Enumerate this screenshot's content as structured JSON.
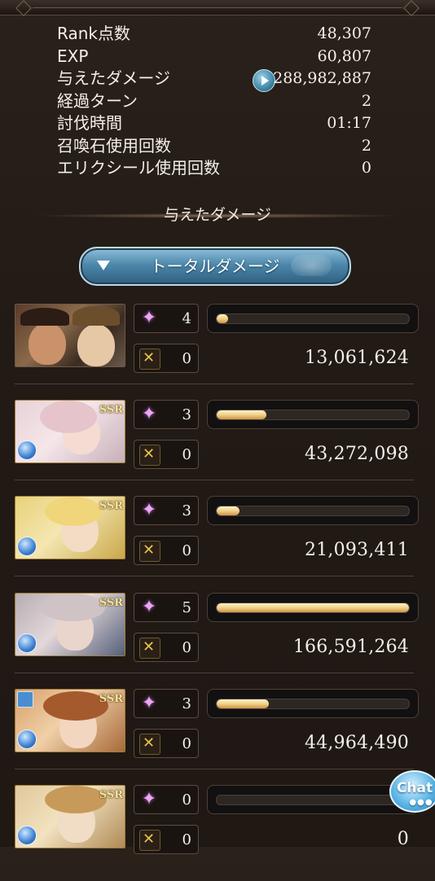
{
  "stats": [
    {
      "label": "Rank点数",
      "value": "48,307"
    },
    {
      "label": "EXP",
      "value": "60,807"
    },
    {
      "label": "与えたダメージ",
      "value": "288,982,887"
    },
    {
      "label": "経過ターン",
      "value": "2"
    },
    {
      "label": "討伐時間",
      "value": "01:17"
    },
    {
      "label": "召喚石使用回数",
      "value": "2"
    },
    {
      "label": "エリクシール使用回数",
      "value": "0"
    }
  ],
  "section_title": "与えたダメージ",
  "dropdown": {
    "label": "トータルダメージ"
  },
  "rarity_label": "SSR",
  "chat_label": "Chat",
  "characters": [
    {
      "turns": "4",
      "ca": "0",
      "damage": "13,061,624",
      "bar_fraction": 0.06,
      "ssr": false
    },
    {
      "turns": "3",
      "ca": "0",
      "damage": "43,272,098",
      "bar_fraction": 0.26,
      "ssr": true
    },
    {
      "turns": "3",
      "ca": "0",
      "damage": "21,093,411",
      "bar_fraction": 0.12,
      "ssr": true
    },
    {
      "turns": "5",
      "ca": "0",
      "damage": "166,591,264",
      "bar_fraction": 1.0,
      "ssr": true
    },
    {
      "turns": "3",
      "ca": "0",
      "damage": "44,964,490",
      "bar_fraction": 0.27,
      "ssr": true
    },
    {
      "turns": "0",
      "ca": "0",
      "damage": "0",
      "bar_fraction": 0.0,
      "ssr": true
    }
  ],
  "colors": {
    "bar_gold": "#f2cf86",
    "accent_blue": "#4d88ab",
    "chat_blue": "#5bb5e6"
  },
  "icons": {
    "turn": "sparkle-star-icon",
    "ca": "charge-attack-icon",
    "element": "water-element-icon",
    "play": "play-icon",
    "dropdown": "triangle-down-icon"
  }
}
